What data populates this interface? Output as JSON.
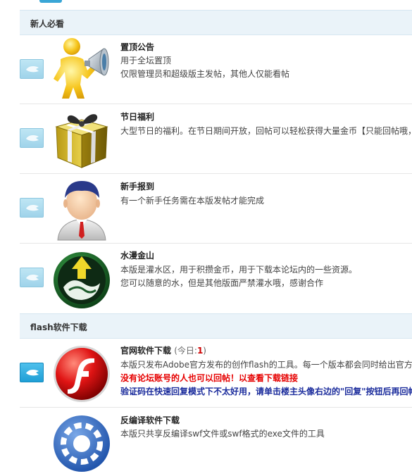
{
  "sections": [
    {
      "title": "新人必看",
      "forums": [
        {
          "name": "置顶公告",
          "desc": [
            "用于全坛置顶",
            "仅限管理员和超级版主发帖，其他人仅能看帖"
          ],
          "icon": "megaphone-man"
        },
        {
          "name": "节日福利",
          "desc": [
            "大型节日的福利。在节日期间开放，回帖可以轻松获得大量金币【只能回帖哦，"
          ],
          "icon": "gift-box"
        },
        {
          "name": "新手报到",
          "desc": [
            "有一个新手任务需在本版发帖才能完成"
          ],
          "icon": "newbie-man"
        },
        {
          "name": "水漫金山",
          "desc": [
            "本版是灌水区，用于积攒金币，用于下载本论坛内的一些资源。",
            "您可以随意的水，但是其他版面严禁灌水哦，感谢合作"
          ],
          "icon": "flood-emblem"
        }
      ]
    },
    {
      "title": "flash软件下载",
      "forums": [
        {
          "name": "官网软件下载",
          "today_label": "(今日:",
          "today_count": "1",
          "today_close": ")",
          "desc": [
            "本版只发布Adobe官方发布的创作flash的工具。每一个版本都会同时给出官方"
          ],
          "notice_red": "没有论坛账号的人也可以回帖！以查看下载链接",
          "notice_blue": "验证码在快速回复模式下不太好用，请单击楼主头像右边的\"回复\"按钮后再回帖",
          "icon": "flash-logo"
        },
        {
          "name": "反编译软件下载",
          "desc": [
            "本版只共享反编译swf文件或swf格式的exe文件的工具"
          ],
          "icon": "gear"
        }
      ]
    }
  ]
}
